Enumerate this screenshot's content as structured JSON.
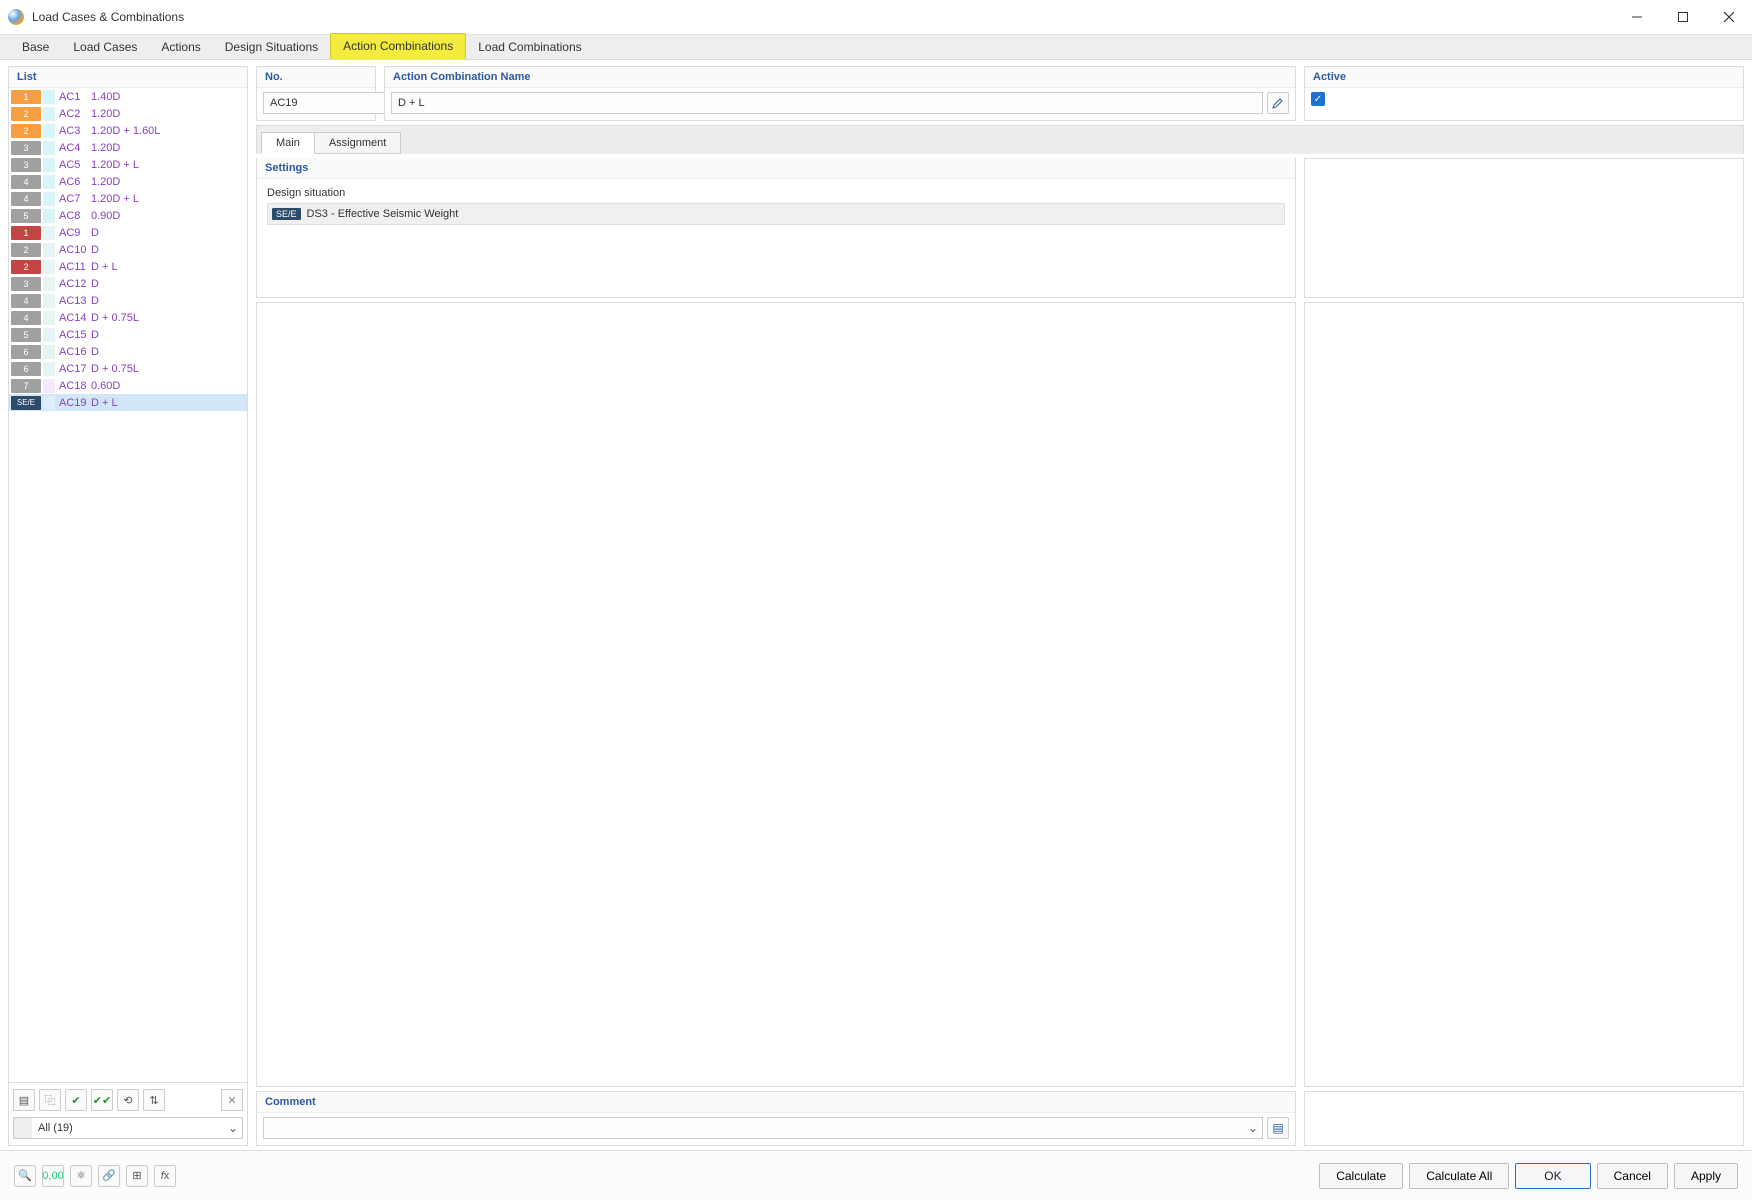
{
  "window": {
    "title": "Load Cases & Combinations"
  },
  "tabs": [
    "Base",
    "Load Cases",
    "Actions",
    "Design Situations",
    "Action Combinations",
    "Load Combinations"
  ],
  "tabs_active": 4,
  "left": {
    "header": "List",
    "rows": [
      {
        "badge": "1",
        "bcls": "b-or1",
        "sw": "s-cy",
        "id": "AC1",
        "desc": "1.40D"
      },
      {
        "badge": "2",
        "bcls": "b-or1",
        "sw": "s-cy",
        "id": "AC2",
        "desc": "1.20D"
      },
      {
        "badge": "2",
        "bcls": "b-or1",
        "sw": "s-cy",
        "id": "AC3",
        "desc": "1.20D + 1.60L"
      },
      {
        "badge": "3",
        "bcls": "b-gy",
        "sw": "s-cy",
        "id": "AC4",
        "desc": "1.20D"
      },
      {
        "badge": "3",
        "bcls": "b-gy",
        "sw": "s-cy",
        "id": "AC5",
        "desc": "1.20D + L"
      },
      {
        "badge": "4",
        "bcls": "b-gy",
        "sw": "s-cy",
        "id": "AC6",
        "desc": "1.20D"
      },
      {
        "badge": "4",
        "bcls": "b-gy",
        "sw": "s-cy",
        "id": "AC7",
        "desc": "1.20D + L"
      },
      {
        "badge": "5",
        "bcls": "b-gy",
        "sw": "s-cy",
        "id": "AC8",
        "desc": "0.90D"
      },
      {
        "badge": "1",
        "bcls": "b-rd",
        "sw": "s-lc",
        "id": "AC9",
        "desc": "D"
      },
      {
        "badge": "2",
        "bcls": "b-gy",
        "sw": "s-lc",
        "id": "AC10",
        "desc": "D"
      },
      {
        "badge": "2",
        "bcls": "b-rd",
        "sw": "s-lc",
        "id": "AC11",
        "desc": "D + L"
      },
      {
        "badge": "3",
        "bcls": "b-gy",
        "sw": "s-lc",
        "id": "AC12",
        "desc": "D"
      },
      {
        "badge": "4",
        "bcls": "b-gy",
        "sw": "s-lc",
        "id": "AC13",
        "desc": "D"
      },
      {
        "badge": "4",
        "bcls": "b-gy",
        "sw": "s-lc",
        "id": "AC14",
        "desc": "D + 0.75L"
      },
      {
        "badge": "5",
        "bcls": "b-gy",
        "sw": "s-lc",
        "id": "AC15",
        "desc": "D"
      },
      {
        "badge": "6",
        "bcls": "b-gy",
        "sw": "s-lc",
        "id": "AC16",
        "desc": "D"
      },
      {
        "badge": "6",
        "bcls": "b-gy",
        "sw": "s-lc",
        "id": "AC17",
        "desc": "D + 0.75L"
      },
      {
        "badge": "7",
        "bcls": "b-gy",
        "sw": "s-pc",
        "id": "AC18",
        "desc": "0.60D"
      },
      {
        "badge": "SE/E",
        "bcls": "b-se",
        "sw": "s-bl",
        "id": "AC19",
        "desc": "D + L",
        "selected": true
      }
    ],
    "filter": "All (19)"
  },
  "header": {
    "no_label": "No.",
    "no_value": "AC19",
    "name_label": "Action Combination Name",
    "name_value": "D + L",
    "active_label": "Active",
    "active_checked": true
  },
  "subtabs": [
    "Main",
    "Assignment"
  ],
  "subtabs_active": 0,
  "settings": {
    "header": "Settings",
    "ds_label": "Design situation",
    "ds_badge": "SE/E",
    "ds_value": "DS3 - Effective Seismic Weight"
  },
  "comment": {
    "label": "Comment",
    "value": ""
  },
  "buttons": {
    "calculate": "Calculate",
    "calculate_all": "Calculate All",
    "ok": "OK",
    "cancel": "Cancel",
    "apply": "Apply"
  }
}
